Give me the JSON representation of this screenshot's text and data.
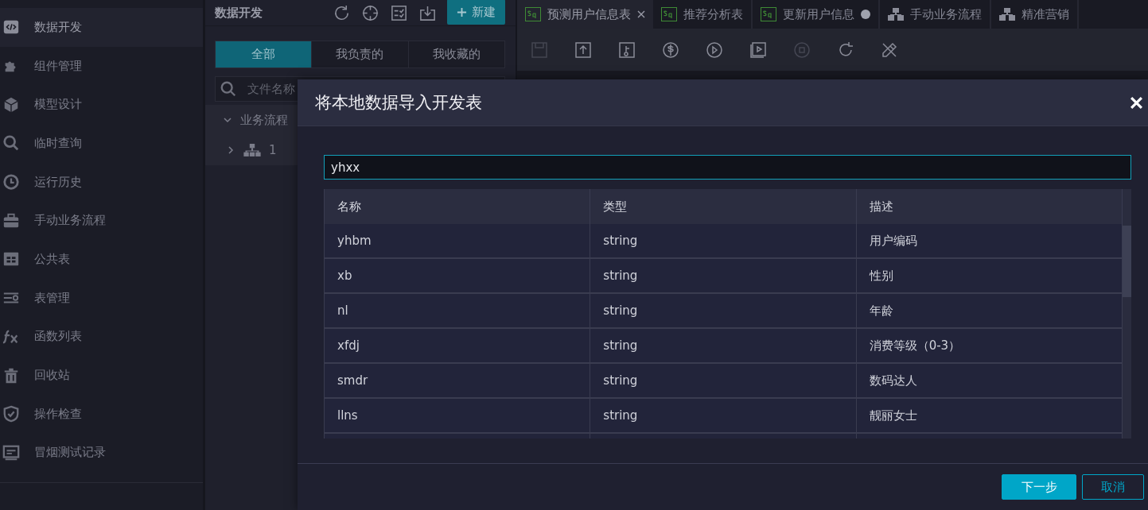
{
  "sidebar": {
    "items": [
      {
        "label": "数据开发",
        "kind": "code",
        "selected": true
      },
      {
        "label": "组件管理",
        "kind": "puzzle",
        "selected": false
      },
      {
        "label": "模型设计",
        "kind": "cube",
        "selected": false
      },
      {
        "label": "临时查询",
        "kind": "search",
        "selected": false
      },
      {
        "label": "运行历史",
        "kind": "clock",
        "selected": false
      },
      {
        "label": "手动业务流程",
        "kind": "briefcase",
        "selected": false
      },
      {
        "label": "公共表",
        "kind": "table",
        "selected": false
      },
      {
        "label": "表管理",
        "kind": "list",
        "selected": false
      },
      {
        "label": "函数列表",
        "kind": "fx",
        "selected": false
      },
      {
        "label": "回收站",
        "kind": "trash",
        "selected": false
      },
      {
        "label": "操作检查",
        "kind": "shield",
        "selected": false
      },
      {
        "label": "冒烟测试记录",
        "kind": "monitor",
        "selected": false
      }
    ]
  },
  "panel": {
    "title": "数据开发",
    "new_button": "新建",
    "filters": [
      {
        "label": "全部",
        "selected": true
      },
      {
        "label": "我负责的",
        "selected": false
      },
      {
        "label": "我收藏的",
        "selected": false
      }
    ],
    "search": {
      "placeholder": "文件名称"
    },
    "tree": [
      {
        "label": "业务流程",
        "expanded": true,
        "children": [
          {
            "label": "1",
            "expanded": false
          }
        ]
      }
    ]
  },
  "editor": {
    "tabs": [
      {
        "label": "预测用户信息表",
        "kind": "sql",
        "selected": true,
        "modified": false
      },
      {
        "label": "推荐分析表",
        "kind": "sql",
        "selected": false,
        "modified": false
      },
      {
        "label": "更新用户信息",
        "kind": "sql",
        "selected": false,
        "modified": true
      },
      {
        "label": "手动业务流程",
        "kind": "flow",
        "selected": false,
        "modified": false
      },
      {
        "label": "精准营销",
        "kind": "flow",
        "selected": false,
        "modified": false
      }
    ],
    "toolbar": [
      {
        "kind": "save",
        "disabled": true
      },
      {
        "kind": "upload",
        "disabled": false
      },
      {
        "kind": "deploy",
        "disabled": false
      },
      {
        "kind": "cost",
        "disabled": false
      },
      {
        "kind": "run",
        "disabled": false
      },
      {
        "kind": "run-advanced",
        "disabled": false
      },
      {
        "kind": "stop",
        "disabled": true
      },
      {
        "kind": "reload",
        "disabled": false
      },
      {
        "kind": "format",
        "disabled": false
      }
    ]
  },
  "dialog": {
    "title": "将本地数据导入开发表",
    "search": {
      "value": "yhxx"
    },
    "table": {
      "columns": [
        "名称",
        "类型",
        "描述"
      ],
      "rows": [
        [
          "yhbm",
          "string",
          "用户编码"
        ],
        [
          "xb",
          "string",
          "性别"
        ],
        [
          "nl",
          "string",
          "年龄"
        ],
        [
          "xfdj",
          "string",
          "消费等级（0-3）"
        ],
        [
          "smdr",
          "string",
          "数码达人"
        ],
        [
          "llns",
          "string",
          "靓丽女士"
        ]
      ]
    },
    "buttons": [
      {
        "label": "下一步",
        "kind": "primary"
      },
      {
        "label": "取消",
        "kind": "secondary"
      }
    ]
  }
}
